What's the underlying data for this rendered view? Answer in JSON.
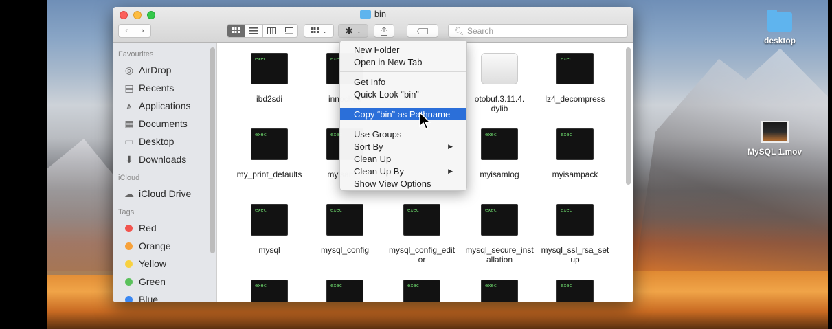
{
  "window": {
    "title": "bin",
    "search_placeholder": "Search"
  },
  "toolbar": {
    "back_icon": "‹",
    "forward_icon": "›",
    "view_icon": "icon-view",
    "list_icon": "list-view",
    "column_icon": "column-view",
    "gallery_icon": "gallery-view"
  },
  "sidebar": {
    "favourites_header": "Favourites",
    "favourites": [
      {
        "label": "AirDrop",
        "icon": "airdrop-icon"
      },
      {
        "label": "Recents",
        "icon": "recents-icon"
      },
      {
        "label": "Applications",
        "icon": "applications-icon"
      },
      {
        "label": "Documents",
        "icon": "documents-icon"
      },
      {
        "label": "Desktop",
        "icon": "desktop-icon"
      },
      {
        "label": "Downloads",
        "icon": "downloads-icon"
      }
    ],
    "icloud_header": "iCloud",
    "icloud_drive": "iCloud Drive",
    "tags_header": "Tags",
    "tags": [
      {
        "label": "Red",
        "color": "#f2544e"
      },
      {
        "label": "Orange",
        "color": "#f7a13a"
      },
      {
        "label": "Yellow",
        "color": "#f8d13f"
      },
      {
        "label": "Green",
        "color": "#5ac15b"
      },
      {
        "label": "Blue",
        "color": "#3a87f2"
      }
    ]
  },
  "files": {
    "exec_text": "exec",
    "row1": [
      "ibd2sdi",
      "innochec",
      "",
      "otobuf.3.11.4.\ndylib",
      "lz4_decompress"
    ],
    "row2": [
      "my_print_defaults",
      "myisam_f",
      "",
      "myisamlog",
      "myisampack"
    ],
    "row3": [
      "mysql",
      "mysql_config",
      "mysql_config_edit\nor",
      "mysql_secure_inst\nallation",
      "mysql_ssl_rsa_set\nup"
    ]
  },
  "context_menu": {
    "new_folder": "New Folder",
    "open_in_new_tab": "Open in New Tab",
    "get_info": "Get Info",
    "quick_look": "Quick Look “bin”",
    "copy_pathname": "Copy “bin” as Pathname",
    "use_groups": "Use Groups",
    "sort_by": "Sort By",
    "clean_up": "Clean Up",
    "clean_up_by": "Clean Up By",
    "show_view_options": "Show View Options",
    "submenu_arrow": "▶"
  },
  "desktop": {
    "folder_label": "desktop",
    "movie_label": "MySQL 1.mov"
  }
}
